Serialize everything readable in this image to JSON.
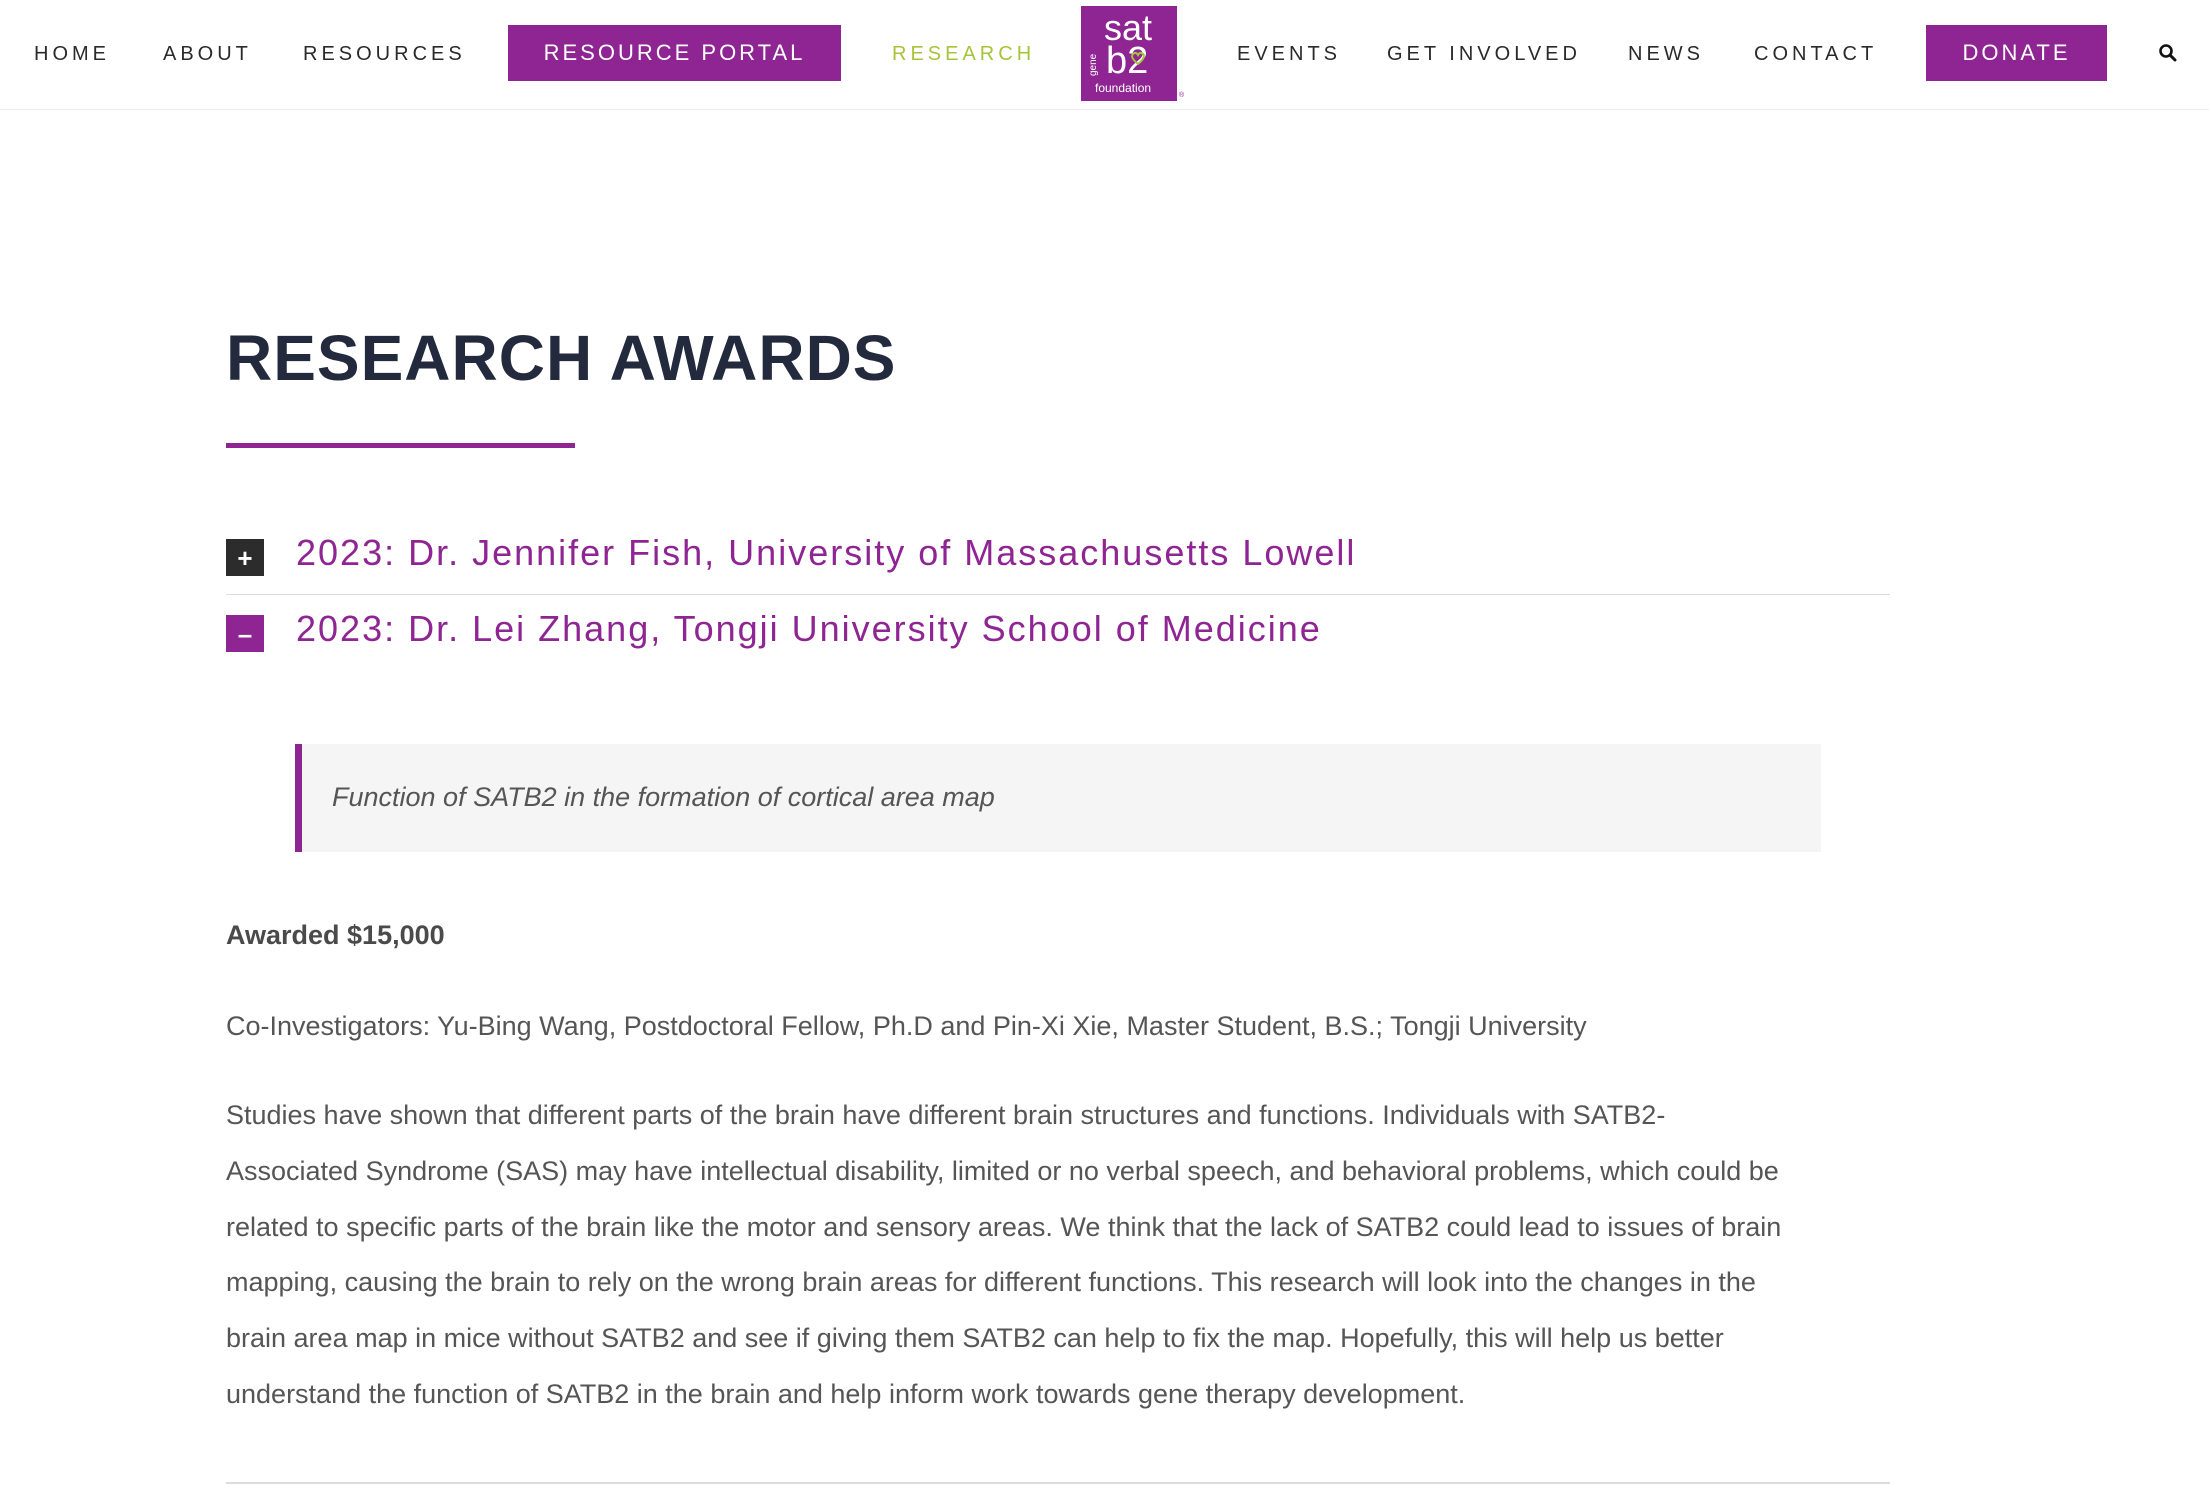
{
  "nav": {
    "home": "HOME",
    "about": "ABOUT",
    "resources": "RESOURCES",
    "resource_portal": "RESOURCE PORTAL",
    "research": "RESEARCH",
    "events": "EVENTS",
    "get_involved": "GET INVOLVED",
    "news": "NEWS",
    "contact": "CONTACT",
    "donate": "DONATE",
    "search_icon": "search-icon"
  },
  "logo": {
    "sat": "sat",
    "gene": "gene",
    "b2": "b2",
    "foundation": "foundation",
    "reg": "®"
  },
  "colors": {
    "brand_purple": "#8e2592",
    "active_green": "#a6c43a",
    "title_navy": "#232a3d"
  },
  "page": {
    "title": "RESEARCH AWARDS"
  },
  "accordion": [
    {
      "toggle": "+",
      "title": "2023: Dr. Jennifer Fish, University of Massachusetts Lowell",
      "state": "collapsed"
    },
    {
      "toggle": "–",
      "title": "2023: Dr. Lei Zhang, Tongji University School of Medicine",
      "state": "expanded"
    }
  ],
  "award": {
    "quote": "Function of SATB2 in the formation of cortical area map",
    "amount": "Awarded $15,000",
    "co_investigators": "Co-Investigators: Yu-Bing Wang, Postdoctoral Fellow, Ph.D and Pin-Xi Xie, Master Student, B.S.; Tongji University",
    "body_lines": [
      "Studies have shown that different parts of the brain have different brain structures and functions. Individuals with SATB2-",
      "Associated Syndrome (SAS) may have intellectual disability, limited or no verbal speech, and behavioral problems, which could be",
      "related to specific parts of the brain like the motor and sensory areas. We think that the lack of SATB2 could lead to issues of brain",
      "mapping, causing the brain to rely on the wrong brain areas for different functions. This research will look into the changes in the",
      "brain area map in mice without SATB2 and see if giving them SATB2 can help to fix the map. Hopefully, this will help us better",
      "understand the function of SATB2 in the brain and help inform work towards gene therapy development."
    ]
  }
}
